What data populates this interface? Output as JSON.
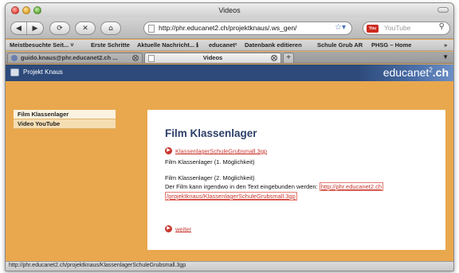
{
  "window": {
    "title": "Videos"
  },
  "toolbar": {
    "back_icon": "arrow-left-icon",
    "forward_icon": "arrow-right-icon",
    "reload_icon": "reload-icon",
    "stop_icon": "stop-icon",
    "home_icon": "home-icon",
    "url": "http://phr.educanet2.ch/projektknaus/.ws_gen/",
    "search_placeholder": "YouTube",
    "search_logo": "You"
  },
  "bookmarks": [
    "Meistbesuchte Seit... ˅",
    "Erste Schritte",
    "Aktuelle Nachricht... ℹ",
    "educanet²",
    "Datenbank editieren",
    "Schule Grub AR",
    "PHSG – Home",
    "»"
  ],
  "tabs": [
    {
      "label": "guido.knaus@phr.educanet2.ch ..."
    },
    {
      "label": "Videos"
    }
  ],
  "site": {
    "name": "Projekt Knaus",
    "brand_light": "educanet",
    "brand_sup": "2",
    "brand_bold": ".ch"
  },
  "sidebar": {
    "items": [
      {
        "label": "Film Klassenlager"
      },
      {
        "label": "Video YouTube"
      }
    ]
  },
  "content": {
    "title": "Film Klassenlager",
    "file_link": "KlassenlagerSchuleGrubsmall.3gp",
    "option1": "Film Klassenlager (1. Möglichkeit)",
    "option2": "Film Klassenlager (2. Möglichkeit)",
    "embed_text": "Der Film kann irgendwo in den Text eingebunden werden:",
    "embed_link_1": "http://phr.educanet2.ch",
    "embed_link_2": "/projektknaus/KlassenlagerSchuleGrubsmall.3gp",
    "next_link": "weiter"
  },
  "status": {
    "url": "http://phr.educanet2.ch/projektknaus/KlassenlagerSchuleGrubsmall.3gp"
  },
  "colors": {
    "page_background": "#e9a84e",
    "header_blue": "#2d4a7a",
    "title_blue": "#2d3f68",
    "link_red": "#c9362e"
  }
}
